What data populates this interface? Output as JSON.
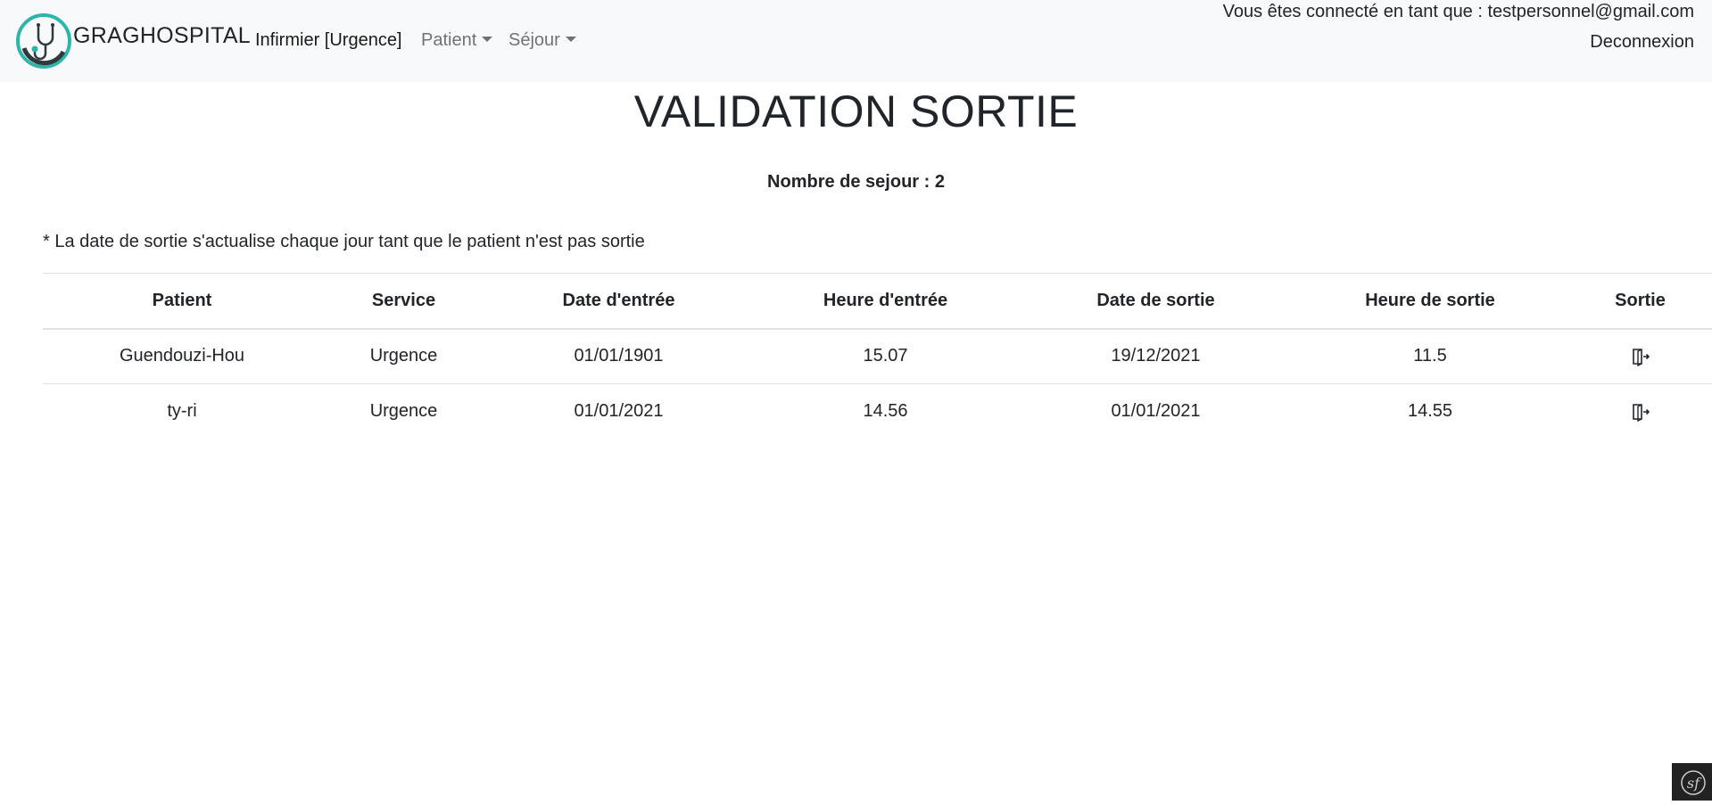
{
  "navbar": {
    "brand": "GRAGHOSPITAL",
    "role": "Infirmier [Urgence]",
    "menu_patient": "Patient",
    "menu_sejour": "Séjour",
    "user_text": "Vous êtes connecté en tant que : testpersonnel@gmail.com",
    "logout": "Deconnexion"
  },
  "page": {
    "title": "VALIDATION SORTIE",
    "count": "Nombre de sejour : 2",
    "note": "* La date de sortie s'actualise chaque jour tant que le patient n'est pas sortie"
  },
  "table": {
    "headers": [
      "Patient",
      "Service",
      "Date d'entrée",
      "Heure d'entrée",
      "Date de sortie",
      "Heure de sortie",
      "Sortie"
    ],
    "rows": [
      [
        "Guendouzi-Hou",
        "Urgence",
        "01/01/1901",
        "15.07",
        "19/12/2021",
        "11.5"
      ],
      [
        "ty-ri",
        "Urgence",
        "01/01/2021",
        "14.56",
        "01/01/2021",
        "14.55"
      ]
    ],
    "action_icon": "door-exit-icon"
  },
  "colors": {
    "navbar_bg": "#f8f9fa",
    "logo_teal": "#2fb5a8",
    "logo_dark": "#2f3a3e",
    "toolbar_bg": "#222222"
  }
}
